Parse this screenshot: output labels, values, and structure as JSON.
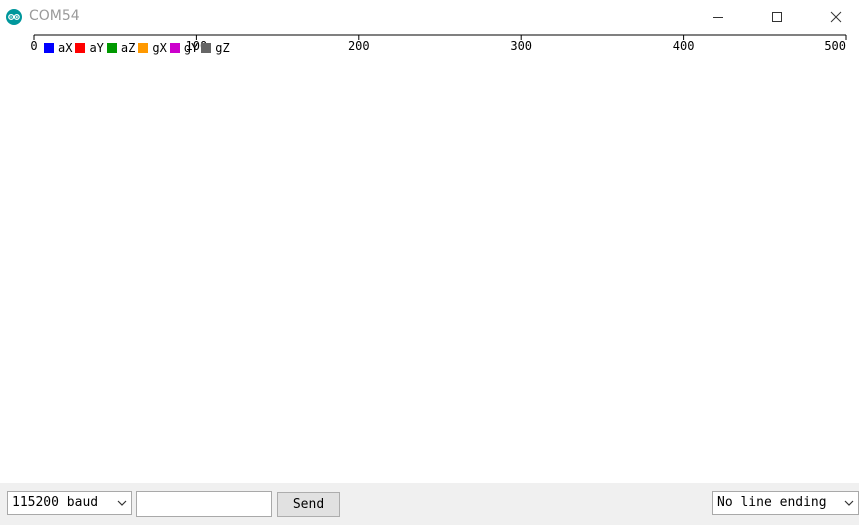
{
  "window": {
    "title": "COM54",
    "icon": "arduino-icon",
    "controls": [
      "minimize-icon",
      "maximize-icon",
      "close-icon"
    ]
  },
  "chart_data": {
    "type": "line",
    "x_ticks": [
      "0",
      "100",
      "200",
      "300",
      "400",
      "500"
    ],
    "xlim": [
      0,
      500
    ],
    "series": [
      {
        "name": "aX",
        "color": "#0000ff",
        "values": []
      },
      {
        "name": "aY",
        "color": "#ff0000",
        "values": []
      },
      {
        "name": "aZ",
        "color": "#009900",
        "values": []
      },
      {
        "name": "gX",
        "color": "#ff9900",
        "values": []
      },
      {
        "name": "gY",
        "color": "#cc00cc",
        "values": []
      },
      {
        "name": "gZ",
        "color": "#666666",
        "values": []
      }
    ],
    "legend": "top-left",
    "grid": false
  },
  "bottom": {
    "baud": "115200 baud",
    "input_value": "",
    "send_label": "Send",
    "line_ending": "No line ending"
  }
}
